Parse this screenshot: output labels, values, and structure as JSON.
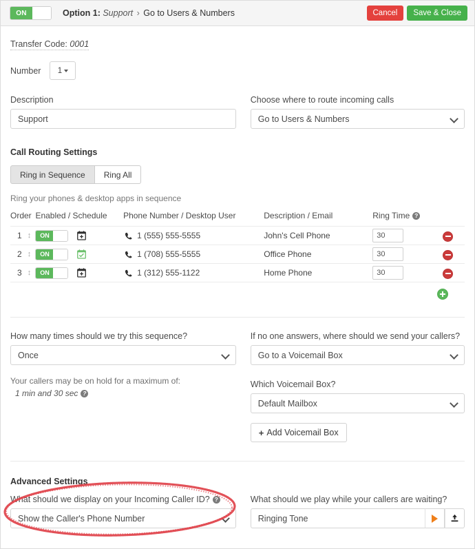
{
  "topbar": {
    "toggle_label": "ON",
    "breadcrumb": {
      "option": "Option 1:",
      "name": "Support",
      "separator": "›",
      "destination": "Go to Users & Numbers"
    },
    "cancel_label": "Cancel",
    "save_label": "Save & Close"
  },
  "form": {
    "transfer_code_label": "Transfer Code:",
    "transfer_code_value": "0001",
    "number_label": "Number",
    "number_value": "1",
    "description_label": "Description",
    "description_value": "Support",
    "route_label": "Choose where to route incoming calls",
    "route_value": "Go to Users & Numbers"
  },
  "call_routing": {
    "section_title": "Call Routing Settings",
    "tabs": [
      {
        "label": "Ring in Sequence",
        "active": true
      },
      {
        "label": "Ring All",
        "active": false
      }
    ],
    "hint": "Ring your phones & desktop apps in sequence",
    "columns": {
      "order": "Order",
      "enabled": "Enabled / Schedule",
      "phone": "Phone Number / Desktop User",
      "description": "Description / Email",
      "ring_time": "Ring Time"
    },
    "rows": [
      {
        "order": "1",
        "enabled_label": "ON",
        "schedule_icon": "calendar-add-icon",
        "schedule_state": "none",
        "phone": "1 (555) 555-5555",
        "description": "John's Cell Phone",
        "ring_time": "30"
      },
      {
        "order": "2",
        "enabled_label": "ON",
        "schedule_icon": "calendar-check-icon",
        "schedule_state": "set",
        "phone": "1 (708) 555-5555",
        "description": "Office Phone",
        "ring_time": "30"
      },
      {
        "order": "3",
        "enabled_label": "ON",
        "schedule_icon": "calendar-add-icon",
        "schedule_state": "none",
        "phone": "1 (312) 555-1122",
        "description": "Home Phone",
        "ring_time": "30"
      }
    ]
  },
  "sequence": {
    "attempts_label": "How many times should we try this sequence?",
    "attempts_value": "Once",
    "hold_note": "Your callers may be on hold for a maximum of:",
    "hold_value": "1 min and 30 sec",
    "no_answer_label": "If no one answers, where should we send your callers?",
    "no_answer_value": "Go to a Voicemail Box",
    "voicemail_label": "Which Voicemail Box?",
    "voicemail_value": "Default Mailbox",
    "add_voicemail_label": "Add Voicemail Box"
  },
  "advanced": {
    "section_title": "Advanced Settings",
    "caller_id_label": "What should we display on your Incoming Caller ID?",
    "caller_id_value": "Show the Caller's Phone Number",
    "waiting_label": "What should we play while your callers are waiting?",
    "waiting_value": "Ringing Tone"
  },
  "colors": {
    "green": "#5cb85c",
    "save_green": "#46b14b",
    "cancel_red": "#e4413d",
    "remove_red": "#cb3b3b",
    "play_orange": "#ef7f1a",
    "annotation_red": "#e0424a"
  }
}
